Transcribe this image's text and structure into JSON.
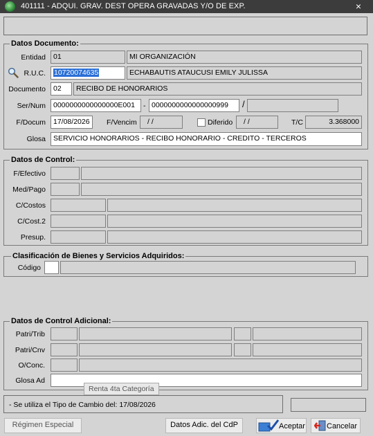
{
  "window": {
    "title": "401111 - ADQUI. GRAV. DEST OPERA GRAVADAS Y/O DE EXP.",
    "close_glyph": "×"
  },
  "doc_section": {
    "legend": "Datos Documento:",
    "entidad_label": "Entidad",
    "entidad_code": "01",
    "entidad_name": "MI ORGANIZACIÓN",
    "ruc_label": "R.U.C.",
    "ruc_value": "10720074635",
    "ruc_name": "ECHABAUTIS ATAUCUSI EMILY JULISSA",
    "documento_label": "Documento",
    "documento_code": "02",
    "documento_name": "RECIBO DE HONORARIOS",
    "sernum_label": "Ser/Num",
    "serie": "0000000000000000E001",
    "dash": "-",
    "numero": "0000000000000000999",
    "slash": "/",
    "fdocum_label": "F/Docum",
    "fdocum_value": "17/08/2026",
    "fvencim_label": "F/Vencim",
    "fvencim_value": "/ /",
    "diferido_label": "Diferido",
    "diferido_value": "/ /",
    "tc_label": "T/C",
    "tc_value": "3.368000",
    "glosa_label": "Glosa",
    "glosa_value": "SERVICIO HONORARIOS - RECIBO HONORARIO - CREDITO - TERCEROS"
  },
  "control_section": {
    "legend": "Datos de Control:",
    "fefectivo_label": "F/Efectivo",
    "medpago_label": "Med/Pago",
    "ccostos_label": "C/Costos",
    "ccost2_label": "C/Cost.2",
    "presup_label": "Presup."
  },
  "clasif_section": {
    "legend": "Clasificación de Bienes y Servicios Adquiridos:",
    "codigo_label": "Código"
  },
  "adicional_section": {
    "legend": "Datos de Control Adicional:",
    "patritrib_label": "Patri/Trib",
    "patricnv_label": "Patri/Cnv",
    "oconc_label": "O/Conc.",
    "glosaad_label": "Glosa Ad"
  },
  "tooltip": "Renta 4ta Categoría",
  "status": {
    "message": "- Se utiliza el Tipo de Cambio del: 17/08/2026"
  },
  "buttons": {
    "regimen": "Régimen Especial",
    "datos_adic": "Datos Adic. del CdP",
    "aceptar": "Aceptar",
    "cancelar": "Cancelar"
  },
  "colors": {
    "titlebar": "#3c3c3c",
    "selection": "#2a6fd6",
    "panel": "#d4d4d4"
  },
  "icons": [
    "app-logo-icon",
    "close-icon",
    "magnifier-icon",
    "accept-icon",
    "cancel-exit-icon"
  ]
}
